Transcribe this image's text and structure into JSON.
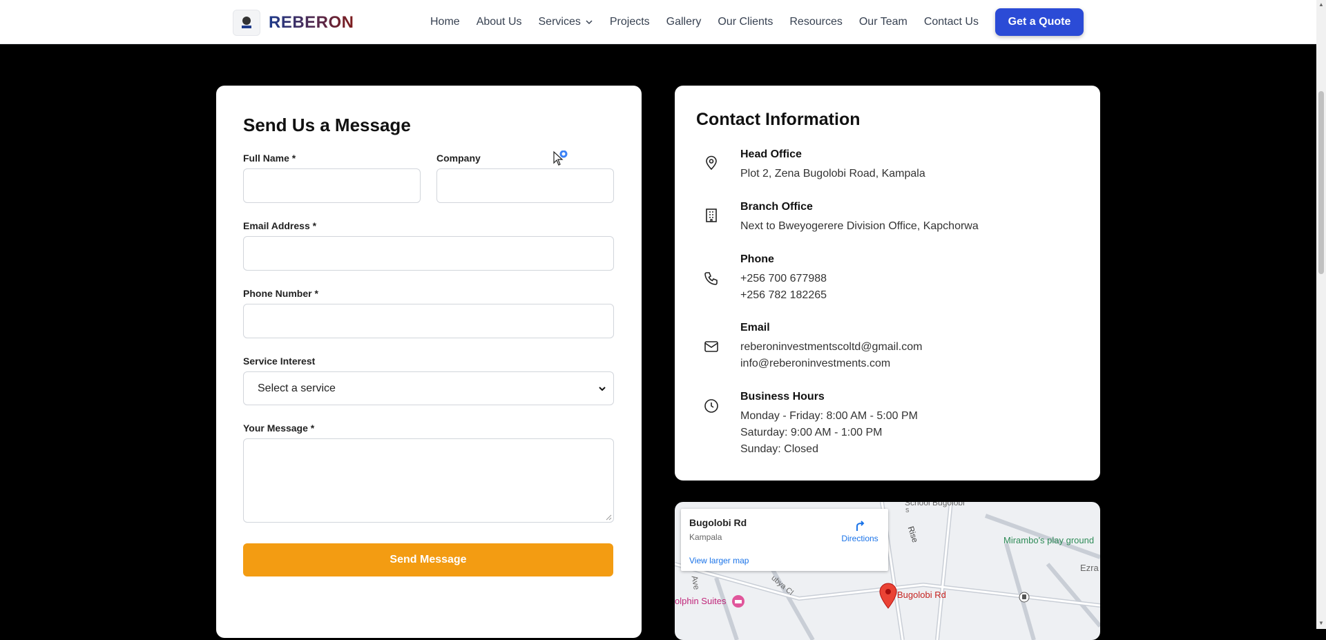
{
  "header": {
    "brand": "REBERON",
    "nav": [
      "Home",
      "About Us",
      "Services",
      "Projects",
      "Gallery",
      "Our Clients",
      "Resources",
      "Our Team",
      "Contact Us"
    ],
    "quote_button": "Get a Quote"
  },
  "form": {
    "title": "Send Us a Message",
    "full_name_label": "Full Name *",
    "company_label": "Company",
    "email_label": "Email Address *",
    "phone_label": "Phone Number *",
    "service_label": "Service Interest",
    "service_selected": "Select a service",
    "message_label": "Your Message *",
    "submit": "Send Message"
  },
  "contact": {
    "title": "Contact Information",
    "head_office_title": "Head Office",
    "head_office_address": "Plot 2, Zena Bugolobi Road, Kampala",
    "branch_office_title": "Branch Office",
    "branch_office_address": "Next to Bweyogerere Division Office, Kapchorwa",
    "phone_title": "Phone",
    "phone_1": "+256 700 677988",
    "phone_2": "+256 782 182265",
    "email_title": "Email",
    "email_1": "reberoninvestmentscoltd@gmail.com",
    "email_2": "info@reberoninvestments.com",
    "hours_title": "Business Hours",
    "hours_1": "Monday - Friday: 8:00 AM - 5:00 PM",
    "hours_2": "Saturday: 9:00 AM - 1:00 PM",
    "hours_3": "Sunday: Closed"
  },
  "map": {
    "place": "Bugolobi Rd",
    "city": "Kampala",
    "directions": "Directions",
    "larger_map": "View larger map",
    "pin_label": "Bugolobi Rd",
    "label_school": "School Bugolobi",
    "label_rise": "Rise",
    "label_playground": "Mirambo's play ground",
    "label_ezra": "Ezra",
    "label_hotel": "olphin Suites",
    "label_ave": "Ave",
    "label_cl": "ubya Cl",
    "label_s": "s"
  },
  "colors": {
    "accent_blue": "#2b4bd6",
    "send_orange": "#f39c12"
  }
}
